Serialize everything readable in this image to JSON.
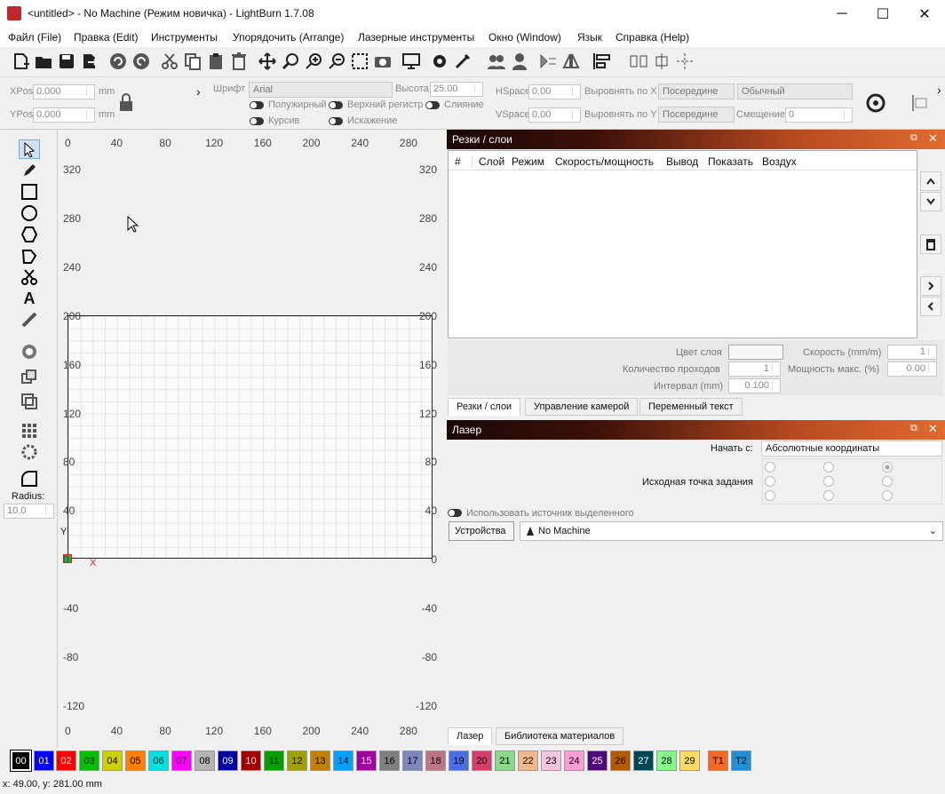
{
  "window": {
    "title": "<untitled> - No Machine (Режим новичка) - LightBurn 1.7.08",
    "minimize": "─",
    "maximize": "☐",
    "close": "✕"
  },
  "menu": [
    "Файл (File)",
    "Правка (Edit)",
    "Инструменты",
    "Упорядочить (Arrange)",
    "Лазерные инструменты",
    "Окно (Window)",
    "Язык",
    "Справка (Help)"
  ],
  "props": {
    "xpos_label": "XPos",
    "xpos": "0.000",
    "ypos_label": "YPos",
    "ypos": "0.000",
    "unit": "mm",
    "font_label": "Шрифт",
    "font": "Arial",
    "height_label": "Высота",
    "height": "25.00",
    "bold": "Полужирный",
    "upper": "Верхний регистр",
    "merge": "Слияние",
    "italic": "Курсив",
    "distort": "Искажение",
    "hspace_label": "HSpace",
    "hspace": "0.00",
    "vspace_label": "VSpace",
    "vspace": "0.00",
    "alignx_label": "Выровнять по X",
    "alignx": "Посередине",
    "aligny_label": "Выровнять по Y",
    "aligny": "Посередине",
    "style": "Обычный",
    "offset_label": "Смещение",
    "offset": "0"
  },
  "left": {
    "radius_label": "Radius:",
    "radius": "10.0"
  },
  "canvas": {
    "xticks": [
      "0",
      "40",
      "80",
      "120",
      "160",
      "200",
      "240",
      "280"
    ],
    "yticks": [
      "320",
      "280",
      "240",
      "200",
      "160",
      "120",
      "80",
      "40",
      "0",
      "-40",
      "-80",
      "-120"
    ],
    "xaxis": "X",
    "yaxis": "Y"
  },
  "layers": {
    "title": "Резки / слои",
    "cols": [
      "#",
      "Слой",
      "Режим",
      "Скорость/мощность",
      "Вывод",
      "Показать",
      "Воздух"
    ],
    "color_label": "Цвет слоя",
    "speed_label": "Скорость (mm/m)",
    "speed": "1",
    "passes_label": "Количество проходов",
    "passes": "1",
    "maxpower_label": "Мощность макс. (%)",
    "maxpower": "0.00",
    "interval_label": "Интервал (mm)",
    "interval": "0.100",
    "tabs": [
      "Резки / слои",
      "Управление камерой",
      "Переменный текст"
    ]
  },
  "laser": {
    "title": "Лазер",
    "start_label": "Начать с:",
    "start": "Абсолютные координаты",
    "origin_label": "Исходная точка задания",
    "use_sel": "Использовать источник выделенного",
    "devices": "Устройства",
    "device": "No Machine",
    "tabs": [
      "Лазер",
      "Библиотека материалов"
    ]
  },
  "palette": [
    {
      "l": "00",
      "c": "#000000"
    },
    {
      "l": "01",
      "c": "#0000ff"
    },
    {
      "l": "02",
      "c": "#ff0000"
    },
    {
      "l": "03",
      "c": "#00c000"
    },
    {
      "l": "04",
      "c": "#d0d000"
    },
    {
      "l": "05",
      "c": "#ff8000"
    },
    {
      "l": "06",
      "c": "#00e0e0"
    },
    {
      "l": "07",
      "c": "#ff00ff"
    },
    {
      "l": "08",
      "c": "#b4b4b4"
    },
    {
      "l": "09",
      "c": "#0000a0"
    },
    {
      "l": "10",
      "c": "#a00000"
    },
    {
      "l": "11",
      "c": "#00a000"
    },
    {
      "l": "12",
      "c": "#a0a000"
    },
    {
      "l": "13",
      "c": "#c08000"
    },
    {
      "l": "14",
      "c": "#00a0ff"
    },
    {
      "l": "15",
      "c": "#a000a0"
    },
    {
      "l": "16",
      "c": "#808080"
    },
    {
      "l": "17",
      "c": "#7d87b9"
    },
    {
      "l": "18",
      "c": "#bb7784"
    },
    {
      "l": "19",
      "c": "#4a6fe3"
    },
    {
      "l": "20",
      "c": "#d33f6a"
    },
    {
      "l": "21",
      "c": "#8cd78c"
    },
    {
      "l": "22",
      "c": "#f0b98d"
    },
    {
      "l": "23",
      "c": "#f6c4e1"
    },
    {
      "l": "24",
      "c": "#fa9ed4"
    },
    {
      "l": "25",
      "c": "#500a78"
    },
    {
      "l": "26",
      "c": "#b45a00"
    },
    {
      "l": "27",
      "c": "#004754"
    },
    {
      "l": "28",
      "c": "#86fa88"
    },
    {
      "l": "29",
      "c": "#ffdb66"
    },
    {
      "l": "T1",
      "c": "#f36926"
    },
    {
      "l": "T2",
      "c": "#1f8fd6"
    }
  ],
  "status": "x: 49.00, y: 281.00 mm"
}
